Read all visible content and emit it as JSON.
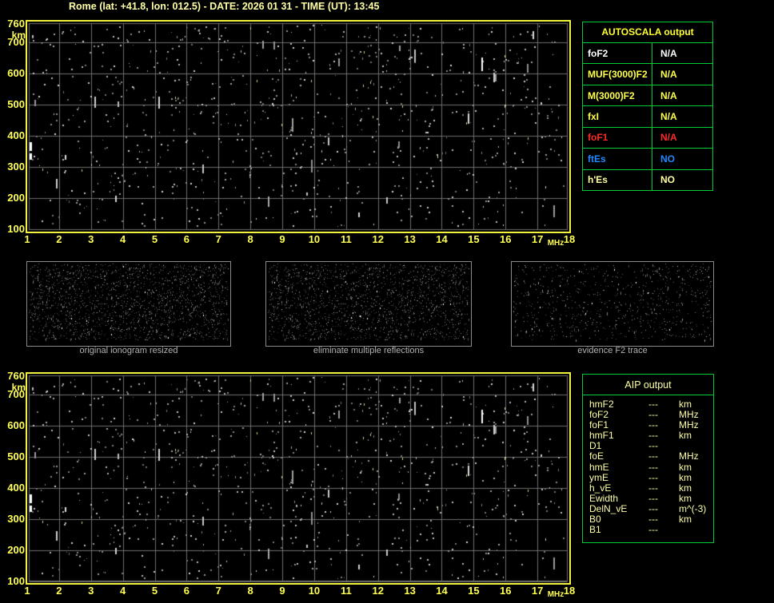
{
  "header": {
    "title": "Rome (lat: +41.8, lon: 012.5) - DATE: 2026 01 31 - TIME (UT): 13:45"
  },
  "axes": {
    "y_unit": "km",
    "x_unit": "MHz",
    "y_ticks": [
      "760",
      "700",
      "600",
      "500",
      "400",
      "300",
      "200",
      "100"
    ],
    "x_ticks": [
      "1",
      "2",
      "3",
      "4",
      "5",
      "6",
      "7",
      "8",
      "9",
      "10",
      "11",
      "12",
      "13",
      "14",
      "15",
      "16",
      "17",
      "18"
    ]
  },
  "autoscala": {
    "title": "AUTOSCALA output",
    "rows": [
      {
        "label": "foF2",
        "value": "N/A",
        "color": "#ffffff"
      },
      {
        "label": "MUF(3000)F2",
        "value": "N/A",
        "color": "#ffff4d"
      },
      {
        "label": "M(3000)F2",
        "value": "N/A",
        "color": "#ffff4d"
      },
      {
        "label": "fxI",
        "value": "N/A",
        "color": "#ffff4d"
      },
      {
        "label": "foF1",
        "value": "N/A",
        "color": "#ff2a2a"
      },
      {
        "label": "ftEs",
        "value": "NO",
        "color": "#2288ff"
      },
      {
        "label": "h'Es",
        "value": "NO",
        "color": "#ffffa0"
      }
    ]
  },
  "panels": [
    {
      "caption": "original ionogram resized"
    },
    {
      "caption": "eliminate multiple reflections"
    },
    {
      "caption": "evidence F2 trace"
    }
  ],
  "aip": {
    "title": "AIP output",
    "rows": [
      {
        "label": "hmF2",
        "value": "---",
        "unit": "km"
      },
      {
        "label": "foF2",
        "value": "---",
        "unit": "MHz"
      },
      {
        "label": "foF1",
        "value": "---",
        "unit": "MHz"
      },
      {
        "label": "hmF1",
        "value": "---",
        "unit": "km"
      },
      {
        "label": "D1",
        "value": "---",
        "unit": ""
      },
      {
        "label": "foE",
        "value": "---",
        "unit": "MHz"
      },
      {
        "label": "hmE",
        "value": "---",
        "unit": "km"
      },
      {
        "label": "ymE",
        "value": "---",
        "unit": "km"
      },
      {
        "label": "h_vE",
        "value": "---",
        "unit": "km"
      },
      {
        "label": "Ewidth",
        "value": "---",
        "unit": "km"
      },
      {
        "label": "DelN_vE",
        "value": "---",
        "unit": "m^(-3)"
      },
      {
        "label": "B0",
        "value": "---",
        "unit": "km"
      },
      {
        "label": "B1",
        "value": "---",
        "unit": ""
      }
    ]
  },
  "colors": {
    "plot_border": "#f2f23c",
    "grid": "#6e6e6e",
    "axis_text": "#ffff55",
    "title_text": "#ffffa6",
    "table_border": "#00cc33",
    "caption_text": "#b2b2b2",
    "pale_yellow": "#ffffa6"
  },
  "noise": {
    "iono_seed": 1337,
    "iono_dots": 880,
    "iono_streaks": 26,
    "iono_bright": [
      [
        568,
        45,
        2,
        17
      ],
      [
        3,
        151,
        3,
        11
      ],
      [
        3,
        165,
        3,
        8
      ]
    ],
    "panel12_seed": 4242,
    "panel1_dots": 1900,
    "panel2_dots": 1800,
    "panel3_seed": 9099,
    "panel3_dots": 760
  }
}
